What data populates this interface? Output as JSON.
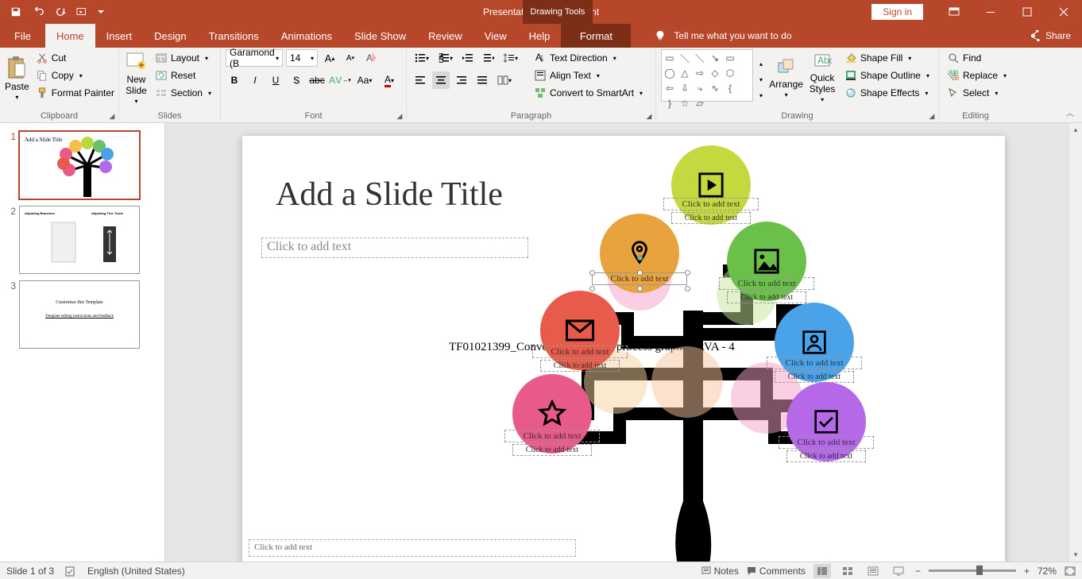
{
  "titlebar": {
    "doc_title": "Presentation2 - PowerPoint",
    "context_tool": "Drawing Tools",
    "signin": "Sign in"
  },
  "tabs": {
    "file": "File",
    "home": "Home",
    "insert": "Insert",
    "design": "Design",
    "transitions": "Transitions",
    "animations": "Animations",
    "slideshow": "Slide Show",
    "review": "Review",
    "view": "View",
    "help": "Help",
    "format": "Format",
    "tellme": "Tell me what you want to do",
    "share": "Share"
  },
  "ribbon": {
    "clipboard": {
      "label": "Clipboard",
      "paste": "Paste",
      "cut": "Cut",
      "copy": "Copy",
      "format_painter": "Format Painter"
    },
    "slides": {
      "label": "Slides",
      "new_slide": "New\nSlide",
      "layout": "Layout",
      "reset": "Reset",
      "section": "Section"
    },
    "font": {
      "label": "Font",
      "name": "Garamond (B",
      "size": "14"
    },
    "paragraph": {
      "label": "Paragraph",
      "text_direction": "Text Direction",
      "align_text": "Align Text",
      "smartart": "Convert to SmartArt"
    },
    "drawing": {
      "label": "Drawing",
      "arrange": "Arrange",
      "quick_styles": "Quick\nStyles",
      "shape_fill": "Shape Fill",
      "shape_outline": "Shape Outline",
      "shape_effects": "Shape Effects"
    },
    "editing": {
      "label": "Editing",
      "find": "Find",
      "replace": "Replace",
      "select": "Select"
    }
  },
  "thumbs": {
    "n1": "1",
    "n2": "2",
    "n3": "3",
    "t1_title": "Add a Slide Title",
    "t2_l": "Adjusting Branches",
    "t2_r": "Adjusting Tree Trunk",
    "t3_a": "Customize this Template",
    "t3_b": "Template editing instructions and feedback"
  },
  "slide": {
    "title": "Add a Slide Title",
    "subtext": "Click to add text",
    "footer": "Click to add text",
    "watermark": "TF01021399_Conveyor belt multi-process graphic_RVA - 4",
    "click_main": "Click to add text",
    "click_sub": "Click to add text"
  },
  "status": {
    "slide": "Slide 1 of 3",
    "lang": "English (United States)",
    "notes": "Notes",
    "comments": "Comments",
    "zoom": "72%"
  }
}
